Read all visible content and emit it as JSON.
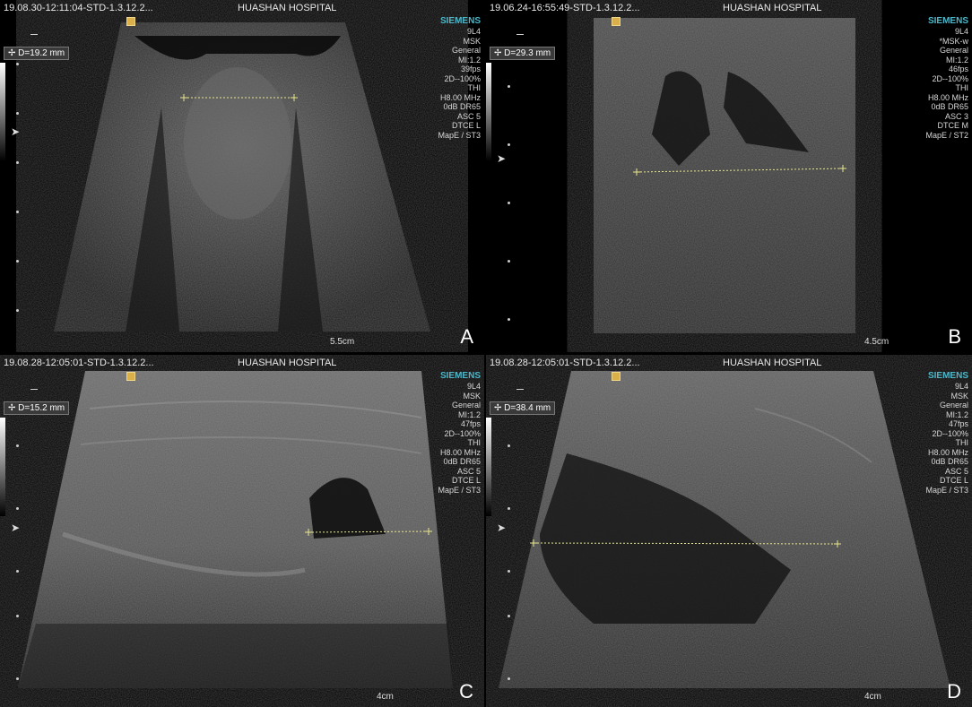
{
  "panels": {
    "A": {
      "header": "19.08.30-12:11:04-STD-1.3.12.2...",
      "hospital": "HUASHAN HOSPITAL",
      "brand": "SIEMENS",
      "params": [
        "9L4",
        "MSK",
        "General",
        "MI:1.2",
        "39fps",
        "2D--100%",
        "THI",
        "H8.00 MHz",
        "0dB DR65",
        "ASC 5",
        "DTCE L",
        "MapE / ST3"
      ],
      "measurement": "D=19.2 mm",
      "depth": "5.5cm",
      "letter": "A"
    },
    "B": {
      "header": "19.06.24-16:55:49-STD-1.3.12.2...",
      "hospital": "HUASHAN HOSPITAL",
      "brand": "SIEMENS",
      "params": [
        "9L4",
        "*MSK-w",
        "General",
        "MI:1.2",
        "46fps",
        "2D--100%",
        "THI",
        "H8.00 MHz",
        "0dB DR65",
        "ASC 3",
        "DTCE M",
        "MapE / ST2"
      ],
      "measurement": "D=29.3 mm",
      "depth": "4.5cm",
      "letter": "B"
    },
    "C": {
      "header": "19.08.28-12:05:01-STD-1.3.12.2...",
      "hospital": "HUASHAN HOSPITAL",
      "brand": "SIEMENS",
      "params": [
        "9L4",
        "MSK",
        "General",
        "MI:1.2",
        "47fps",
        "2D--100%",
        "THI",
        "H8.00 MHz",
        "0dB DR65",
        "ASC 5",
        "DTCE L",
        "MapE / ST3"
      ],
      "measurement": "D=15.2 mm",
      "depth": "4cm",
      "letter": "C"
    },
    "D": {
      "header": "19.08.28-12:05:01-STD-1.3.12.2...",
      "hospital": "HUASHAN HOSPITAL",
      "brand": "SIEMENS",
      "params": [
        "9L4",
        "MSK",
        "General",
        "MI:1.2",
        "47fps",
        "2D--100%",
        "THI",
        "H8.00 MHz",
        "0dB DR65",
        "ASC 5",
        "DTCE L",
        "MapE / ST3"
      ],
      "measurement": "D=38.4 mm",
      "depth": "4cm",
      "letter": "D"
    }
  }
}
